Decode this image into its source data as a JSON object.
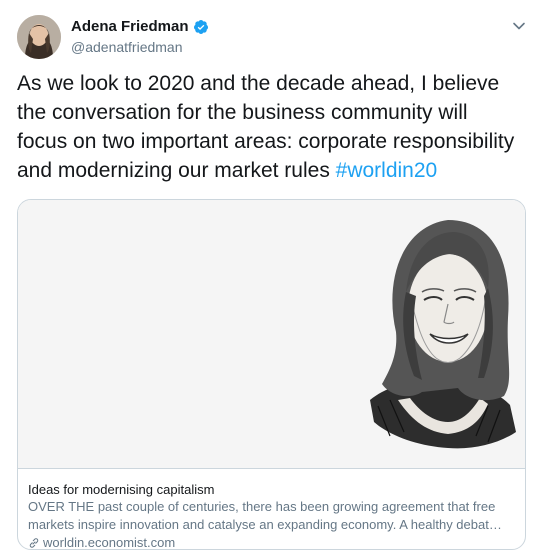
{
  "author": {
    "name": "Adena Friedman",
    "handle": "@adenatfriedman",
    "verified": true
  },
  "tweet": {
    "text": "As we look to 2020 and the decade ahead, I believe the conversation for the business community will focus on two important areas: corporate responsibility and modernizing our market rules ",
    "hashtag": "#worldin20"
  },
  "card": {
    "title": "Ideas for modernising capitalism",
    "description": "OVER THE past couple of centuries, there has been growing agreement that free markets inspire innovation and catalyse an expanding economy. A healthy debat…",
    "domain": "worldin.economist.com"
  },
  "icons": {
    "verified": "verified-badge-icon",
    "caret": "chevron-down-icon",
    "link": "link-icon"
  },
  "colors": {
    "accent": "#1da1f2",
    "secondary_text": "#657786",
    "border": "#ccd6dd"
  }
}
